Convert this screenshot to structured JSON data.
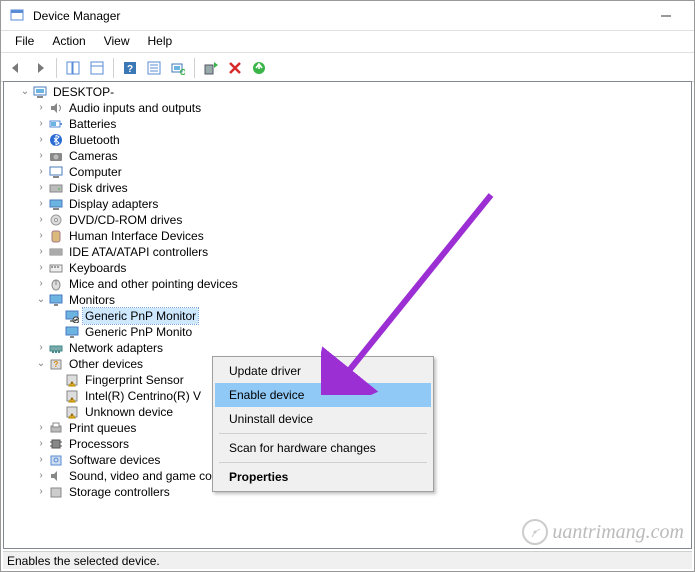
{
  "window": {
    "title": "Device Manager"
  },
  "menubar": {
    "file": "File",
    "action": "Action",
    "view": "View",
    "help": "Help"
  },
  "tree": {
    "root": "DESKTOP-",
    "audio": "Audio inputs and outputs",
    "batteries": "Batteries",
    "bluetooth": "Bluetooth",
    "cameras": "Cameras",
    "computer": "Computer",
    "disk_drives": "Disk drives",
    "display_adapters": "Display adapters",
    "dvd": "DVD/CD-ROM drives",
    "hid": "Human Interface Devices",
    "ide": "IDE ATA/ATAPI controllers",
    "keyboards": "Keyboards",
    "mice": "Mice and other pointing devices",
    "monitors": "Monitors",
    "monitor1": "Generic PnP Monitor",
    "monitor2": "Generic PnP Monito",
    "network": "Network adapters",
    "other": "Other devices",
    "fingerprint": "Fingerprint Sensor",
    "centrino": "Intel(R) Centrino(R) V",
    "unknown": "Unknown device",
    "print_queues": "Print queues",
    "processors": "Processors",
    "software": "Software devices",
    "sound": "Sound, video and game controllers",
    "storage": "Storage controllers"
  },
  "context": {
    "update": "Update driver",
    "enable": "Enable device",
    "uninstall": "Uninstall device",
    "scan": "Scan for hardware changes",
    "properties": "Properties"
  },
  "status": "Enables the selected device.",
  "watermark": "uantrimang.com"
}
